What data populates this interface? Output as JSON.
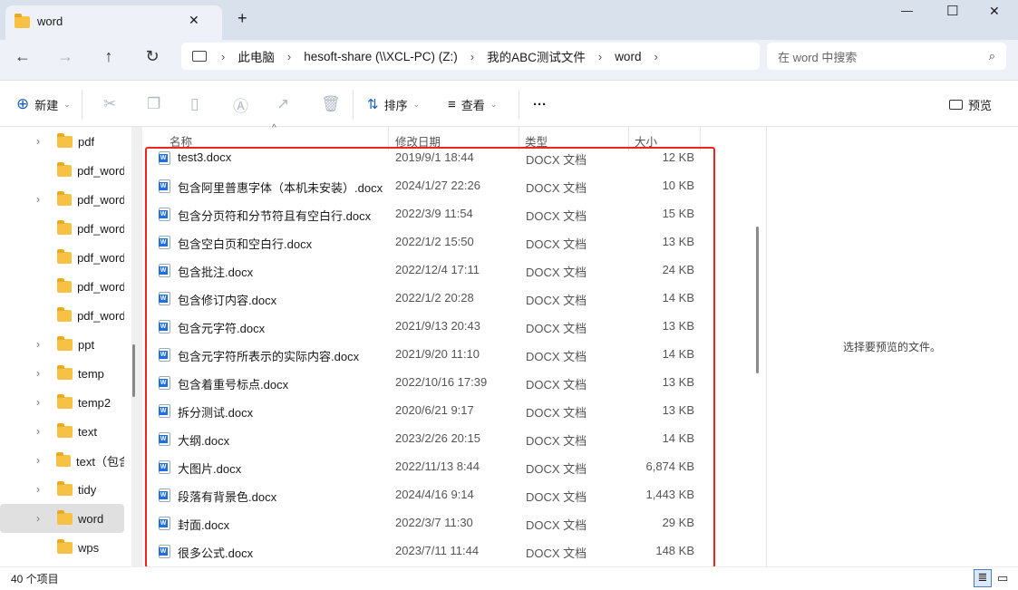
{
  "window": {
    "tab_title": "word",
    "new_tab": "+",
    "minimize": "—",
    "maximize": "☐",
    "close": "✕",
    "tab_close": "✕"
  },
  "nav": {
    "back": "←",
    "forward": "→",
    "up": "↑",
    "refresh": "↻"
  },
  "breadcrumb": [
    "此电脑",
    "hesoft-share (\\\\XCL-PC) (Z:)",
    "我的ABC测试文件",
    "word"
  ],
  "search": {
    "placeholder": "在 word 中搜索"
  },
  "toolbar": {
    "new": "新建",
    "sort": "排序",
    "view": "查看",
    "more": "···",
    "preview": "预览"
  },
  "sidebar": {
    "items": [
      {
        "label": "pdf",
        "expandable": true
      },
      {
        "label": "pdf_word",
        "expandable": false
      },
      {
        "label": "pdf_word",
        "expandable": true
      },
      {
        "label": "pdf_word",
        "expandable": false
      },
      {
        "label": "pdf_word",
        "expandable": false
      },
      {
        "label": "pdf_word",
        "expandable": false
      },
      {
        "label": "pdf_word",
        "expandable": false
      },
      {
        "label": "ppt",
        "expandable": true
      },
      {
        "label": "temp",
        "expandable": true
      },
      {
        "label": "temp2",
        "expandable": true
      },
      {
        "label": "text",
        "expandable": true
      },
      {
        "label": "text（包含",
        "expandable": true
      },
      {
        "label": "tidy",
        "expandable": true
      },
      {
        "label": "word",
        "expandable": true,
        "selected": true
      },
      {
        "label": "wps",
        "expandable": false
      }
    ]
  },
  "columns": {
    "name": "名称",
    "date": "修改日期",
    "type": "类型",
    "size": "大小"
  },
  "files": [
    {
      "name": "test3.docx",
      "date": "2019/9/1 18:44",
      "type": "DOCX 文档",
      "size": "12 KB"
    },
    {
      "name": "包含阿里普惠字体（本机未安装）.docx",
      "date": "2024/1/27 22:26",
      "type": "DOCX 文档",
      "size": "10 KB"
    },
    {
      "name": "包含分页符和分节符且有空白行.docx",
      "date": "2022/3/9 11:54",
      "type": "DOCX 文档",
      "size": "15 KB"
    },
    {
      "name": "包含空白页和空白行.docx",
      "date": "2022/1/2 15:50",
      "type": "DOCX 文档",
      "size": "13 KB"
    },
    {
      "name": "包含批注.docx",
      "date": "2022/12/4 17:11",
      "type": "DOCX 文档",
      "size": "24 KB"
    },
    {
      "name": "包含修订内容.docx",
      "date": "2022/1/2 20:28",
      "type": "DOCX 文档",
      "size": "14 KB"
    },
    {
      "name": "包含元字符.docx",
      "date": "2021/9/13 20:43",
      "type": "DOCX 文档",
      "size": "13 KB"
    },
    {
      "name": "包含元字符所表示的实际内容.docx",
      "date": "2021/9/20 11:10",
      "type": "DOCX 文档",
      "size": "14 KB"
    },
    {
      "name": "包含着重号标点.docx",
      "date": "2022/10/16 17:39",
      "type": "DOCX 文档",
      "size": "13 KB"
    },
    {
      "name": "拆分测试.docx",
      "date": "2020/6/21 9:17",
      "type": "DOCX 文档",
      "size": "13 KB"
    },
    {
      "name": "大纲.docx",
      "date": "2023/2/26 20:15",
      "type": "DOCX 文档",
      "size": "14 KB"
    },
    {
      "name": "大图片.docx",
      "date": "2022/11/13 8:44",
      "type": "DOCX 文档",
      "size": "6,874 KB"
    },
    {
      "name": "段落有背景色.docx",
      "date": "2024/4/16 9:14",
      "type": "DOCX 文档",
      "size": "1,443 KB"
    },
    {
      "name": "封面.docx",
      "date": "2022/3/7 11:30",
      "type": "DOCX 文档",
      "size": "29 KB"
    },
    {
      "name": "很多公式.docx",
      "date": "2023/7/11 11:44",
      "type": "DOCX 文档",
      "size": "148 KB"
    }
  ],
  "preview_text": "选择要预览的文件。",
  "status": {
    "count": "40 个项目"
  }
}
